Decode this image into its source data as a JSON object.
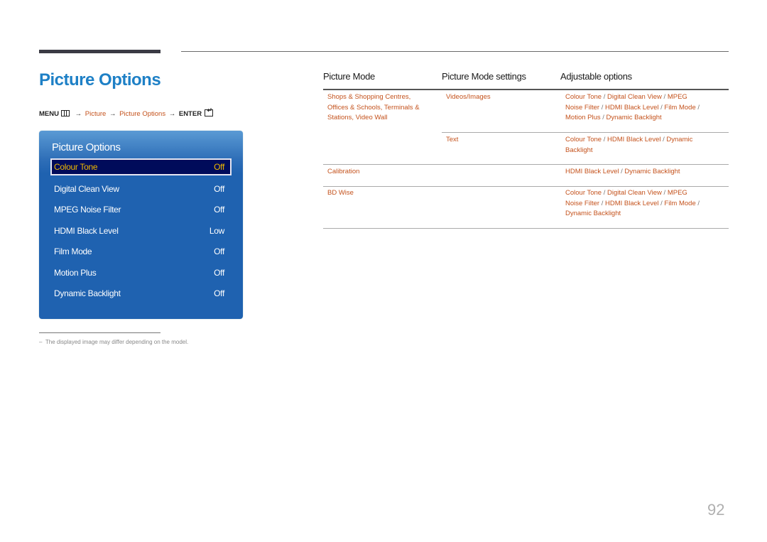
{
  "page": {
    "title": "Picture Options",
    "page_number": "92",
    "footnote": "The displayed image may differ depending on the model."
  },
  "breadcrumb": {
    "menu": "MENU",
    "menu_icon": "menu-grid-icon",
    "step1": "Picture",
    "step2": "Picture Options",
    "enter": "ENTER",
    "enter_icon": "enter-icon",
    "arrow": "→"
  },
  "osd": {
    "title": "Picture Options",
    "items": [
      {
        "label": "Colour Tone",
        "value": "Off",
        "selected": true
      },
      {
        "label": "Digital Clean View",
        "value": "Off"
      },
      {
        "label": "MPEG Noise Filter",
        "value": "Off"
      },
      {
        "label": "HDMI Black Level",
        "value": "Low"
      },
      {
        "label": "Film Mode",
        "value": "Off"
      },
      {
        "label": "Motion Plus",
        "value": "Off"
      },
      {
        "label": "Dynamic Backlight",
        "value": "Off"
      }
    ]
  },
  "table": {
    "headers": [
      "Picture Mode",
      "Picture Mode settings",
      "Adjustable options"
    ],
    "rows": [
      {
        "mode": [
          "Shops & Shopping Centres,",
          "Offices & Schools, Terminals &",
          "Stations, Video Wall"
        ],
        "setting": "Videos/Images",
        "options": [
          "Colour Tone / Digital Clean View / MPEG",
          "Noise Filter / HDMI Black Level / Film Mode /",
          "Motion Plus / Dynamic Backlight"
        ]
      },
      {
        "mode": [],
        "setting": "Text",
        "options": [
          "Colour Tone / HDMI Black Level / Dynamic",
          "Backlight"
        ]
      },
      {
        "mode": [
          "Calibration"
        ],
        "setting": "",
        "options": [
          "HDMI Black Level / Dynamic Backlight"
        ]
      },
      {
        "mode": [
          "BD Wise"
        ],
        "setting": "",
        "options": [
          "Colour Tone / Digital Clean View / MPEG",
          "Noise Filter / HDMI Black Level / Film Mode /",
          "Dynamic Backlight"
        ]
      }
    ]
  },
  "colors": {
    "title_blue": "#1e80c6",
    "link_orange": "#c4521c",
    "osd_blue": "#1f62b0",
    "osd_selected_bg": "#000b5a",
    "osd_selected_text": "#f0b800"
  }
}
